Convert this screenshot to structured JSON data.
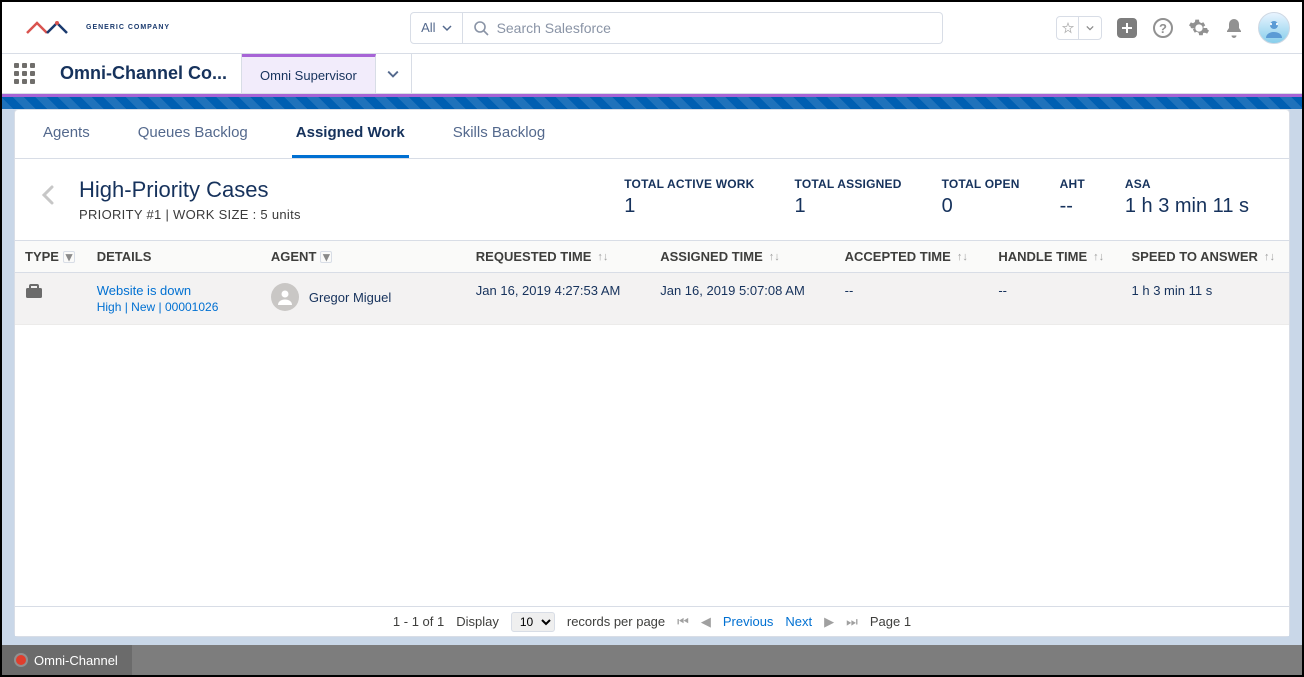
{
  "header": {
    "logo_text": "GENERIC COMPANY",
    "search_scope": "All",
    "search_placeholder": "Search Salesforce"
  },
  "appbar": {
    "app_name": "Omni-Channel Co...",
    "active_nav": "Omni Supervisor"
  },
  "tabs": {
    "agents": "Agents",
    "queues_backlog": "Queues Backlog",
    "assigned_work": "Assigned Work",
    "skills_backlog": "Skills Backlog"
  },
  "queue": {
    "title": "High-Priority Cases",
    "subtitle": "PRIORITY #1  |  WORK SIZE : 5 units"
  },
  "metrics": {
    "active_work": {
      "label": "TOTAL ACTIVE WORK",
      "value": "1"
    },
    "assigned": {
      "label": "TOTAL ASSIGNED",
      "value": "1"
    },
    "open": {
      "label": "TOTAL OPEN",
      "value": "0"
    },
    "aht": {
      "label": "AHT",
      "value": "--"
    },
    "asa": {
      "label": "ASA",
      "value": "1 h 3 min 11 s"
    }
  },
  "table": {
    "columns": {
      "type": "TYPE",
      "details": "DETAILS",
      "agent": "AGENT",
      "requested": "REQUESTED TIME",
      "assigned": "ASSIGNED TIME",
      "accepted": "ACCEPTED TIME",
      "handle": "HANDLE TIME",
      "sta": "SPEED TO ANSWER"
    },
    "rows": [
      {
        "detail_title": "Website is down",
        "detail_sub": "High | New | 00001026",
        "agent": "Gregor Miguel",
        "requested": "Jan 16, 2019 4:27:53 AM",
        "assigned": "Jan 16, 2019 5:07:08 AM",
        "accepted": "--",
        "handle": "--",
        "sta": "1 h 3 min 11 s"
      }
    ]
  },
  "pager": {
    "range": "1 - 1 of 1",
    "display_label": "Display",
    "page_size": "10",
    "per_page_suffix": "records per page",
    "previous": "Previous",
    "next": "Next",
    "page_label": "Page 1"
  },
  "utility": {
    "item": "Omni-Channel"
  }
}
